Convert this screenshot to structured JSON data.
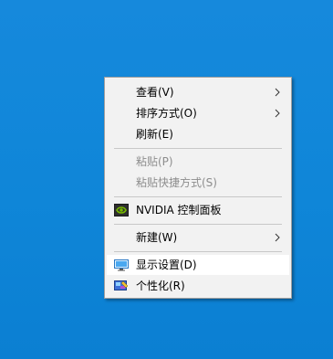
{
  "context_menu": {
    "items": [
      {
        "label": "查看(V)"
      },
      {
        "label": "排序方式(O)"
      },
      {
        "label": "刷新(E)"
      },
      {
        "label": "粘贴(P)"
      },
      {
        "label": "粘贴快捷方式(S)"
      },
      {
        "label": "NVIDIA 控制面板",
        "icon": "nvidia-icon"
      },
      {
        "label": "新建(W)"
      },
      {
        "label": "显示设置(D)",
        "icon": "display-icon"
      },
      {
        "label": "个性化(R)",
        "icon": "personalize-icon"
      }
    ]
  },
  "colors": {
    "desktop_background": "#1189dc",
    "menu_background": "#f2f2f2",
    "menu_border": "#a0a0a0",
    "disabled_text": "#8d8d8d",
    "highlight": "#ffffff"
  }
}
